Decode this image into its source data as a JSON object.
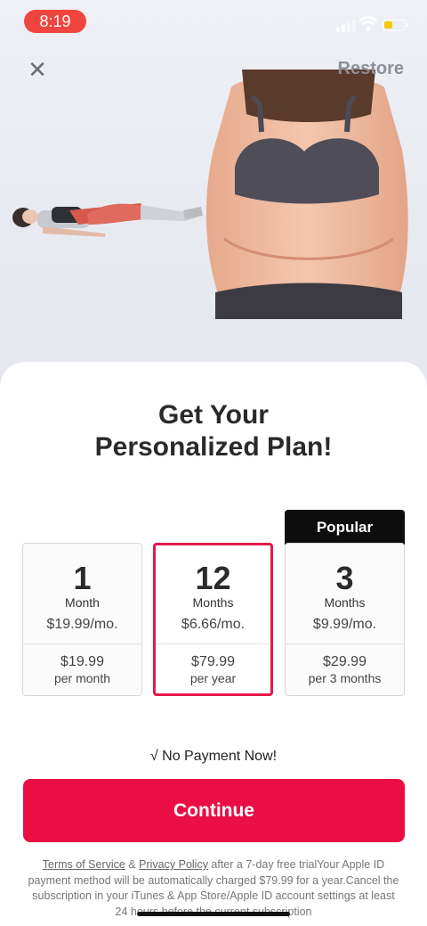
{
  "status_bar": {
    "time": "8:19"
  },
  "header": {
    "restore_label": "Restore"
  },
  "hero": {},
  "headline": {
    "line1": "Get Your",
    "line2": "Personalized Plan!"
  },
  "plans": [
    {
      "count": "1",
      "unit": "Month",
      "monthly_price": "$19.99/mo.",
      "total_price": "$19.99",
      "period": "per month"
    },
    {
      "count": "12",
      "unit": "Months",
      "monthly_price": "$6.66/mo.",
      "total_price": "$79.99",
      "period": "per year"
    },
    {
      "count": "3",
      "unit": "Months",
      "monthly_price": "$9.99/mo.",
      "total_price": "$29.99",
      "period": "per 3 months",
      "badge": "Popular"
    }
  ],
  "no_payment": "√ No Payment Now!",
  "continue_label": "Continue",
  "legal": {
    "terms": "Terms of Service",
    "amp": " & ",
    "privacy": "Privacy Policy",
    "text": "  after a 7-day free trialYour Apple ID payment method will be automatically charged $79.99 for a year.Cancel the subscription in your iTunes & App Store/Apple ID account settings at least 24 hours before the current subscription"
  },
  "colors": {
    "accent": "#ea0e45",
    "time_pill": "#f0453e",
    "badge": "#0d0d0d"
  },
  "icons": {
    "close": "close-icon",
    "wifi": "wifi-icon",
    "battery": "battery-icon",
    "signal": "signal-icon"
  }
}
